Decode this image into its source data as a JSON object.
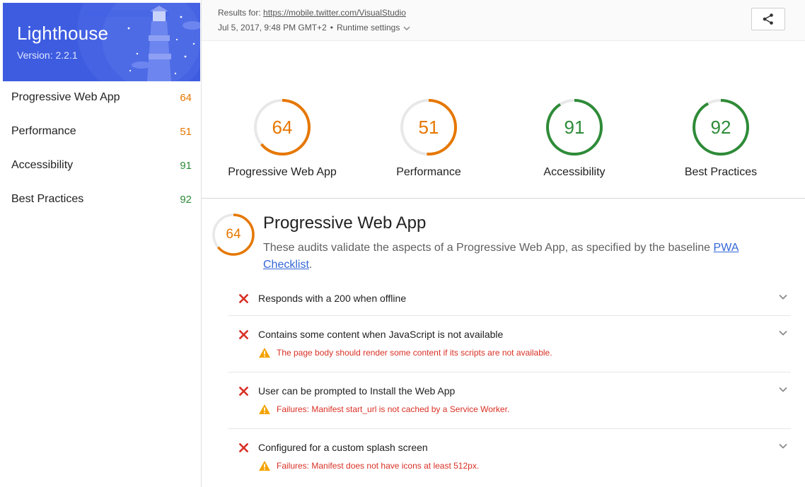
{
  "app": {
    "title": "Lighthouse",
    "version": "Version: 2.2.1"
  },
  "header": {
    "results_label": "Results for:",
    "url": "https://mobile.twitter.com/VisualStudio",
    "date": "Jul 5, 2017, 9:48 PM GMT+2",
    "runtime_label": "Runtime settings",
    "share_icon": "share-icon"
  },
  "colors": {
    "banner": "#3d5ce0",
    "average": "#e67700",
    "pass": "#2e8b38",
    "fail": "#d93025",
    "warning": "#f4a300",
    "link": "#3367d6"
  },
  "nav": [
    {
      "label": "Progressive Web App",
      "score": "64"
    },
    {
      "label": "Performance",
      "score": "51"
    },
    {
      "label": "Accessibility",
      "score": "91"
    },
    {
      "label": "Best Practices",
      "score": "92"
    }
  ],
  "gauges": [
    {
      "label": "Progressive Web App",
      "score": "64",
      "fraction": 0.64
    },
    {
      "label": "Performance",
      "score": "51",
      "fraction": 0.51
    },
    {
      "label": "Accessibility",
      "score": "91",
      "fraction": 0.91
    },
    {
      "label": "Best Practices",
      "score": "92",
      "fraction": 0.92
    }
  ],
  "section": {
    "score": "64",
    "fraction": 0.64,
    "title": "Progressive Web App",
    "description": "These audits validate the aspects of a Progressive Web App, as specified by the baseline ",
    "link_text": "PWA Checklist",
    "after_link": "."
  },
  "audits": [
    {
      "title": "Responds with a 200 when offline",
      "warning": null
    },
    {
      "title": "Contains some content when JavaScript is not available",
      "warning": "The page body should render some content if its scripts are not available."
    },
    {
      "title": "User can be prompted to Install the Web App",
      "warning": "Failures: Manifest start_url is not cached by a Service Worker."
    },
    {
      "title": "Configured for a custom splash screen",
      "warning": "Failures: Manifest does not have icons at least 512px."
    }
  ]
}
